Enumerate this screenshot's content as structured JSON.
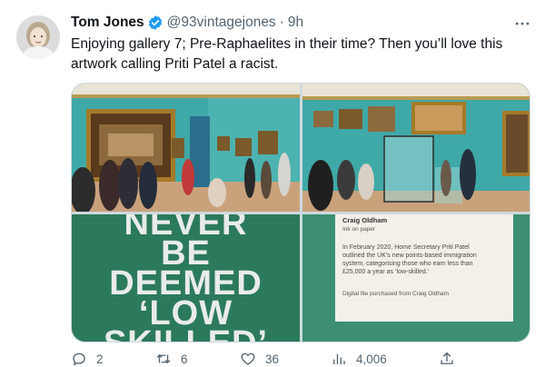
{
  "tweet": {
    "author_name": "Tom Jones",
    "handle": "@93vintagejones",
    "separator": "·",
    "time": "9h",
    "text_line1": "Enjoying gallery 7; Pre-Raphaelites in their time? Then you’ll love this",
    "text_line2": "artwork calling Priti Patel a racist.",
    "verified_icon": "verified-badge-icon",
    "more_icon": "more-options-icon"
  },
  "media": {
    "poster_lines": [
      "NEVER",
      "BE",
      "DEEMED",
      "‘LOW",
      "SKILLED’"
    ],
    "label_card": {
      "title": "Craig Oldham",
      "medium": "Ink on paper",
      "body_lines": [
        "In February 2020, Home Secretary Priti Patel",
        "outlined the UK’s new points-based immigration",
        "system, categorising those who earn less than",
        "£25,000 a year as ‘low-skilled.’"
      ],
      "credit": "Digital file purchased from Craig Oldham"
    }
  },
  "actions": {
    "replies": "2",
    "retweets": "6",
    "likes": "36",
    "views": "4,006"
  },
  "colors": {
    "gallery_wall": "#3fa9a8",
    "poster_green": "#2e7d5f",
    "verified_blue": "#1d9bf0",
    "secondary_text": "#536471"
  }
}
